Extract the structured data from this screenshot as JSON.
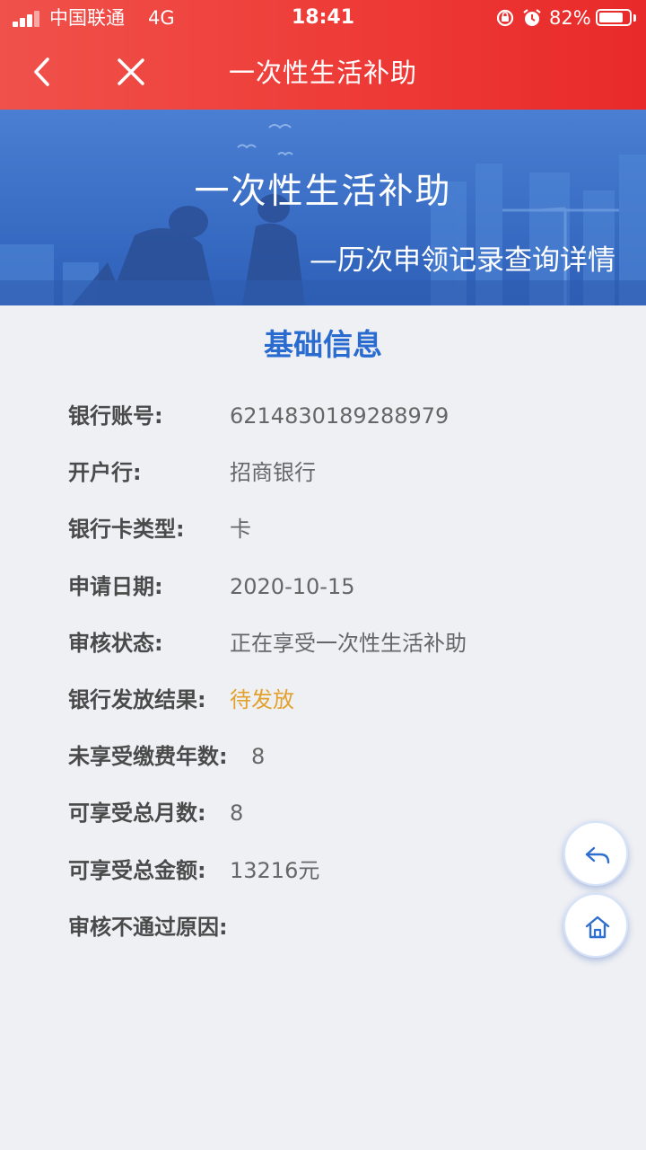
{
  "status_bar": {
    "carrier": "中国联通",
    "network": "4G",
    "time": "18:41",
    "battery_percent": "82%",
    "battery_level": 0.82
  },
  "navbar": {
    "title": "一次性生活补助",
    "back_icon": "chevron-left-icon",
    "close_icon": "close-icon"
  },
  "banner": {
    "title": "一次性生活补助",
    "subtitle": "—历次申领记录查询详情"
  },
  "section": {
    "title": "基础信息"
  },
  "info_rows": [
    {
      "label": "银行账号:",
      "value": "6214830189288979"
    },
    {
      "label": "开户行:",
      "value": "招商银行"
    },
    {
      "label": "银行卡类型:",
      "value": "卡"
    },
    {
      "label": "申请日期:",
      "value": "2020-10-15"
    },
    {
      "label": "审核状态:",
      "value": "正在享受一次性生活补助"
    },
    {
      "label": "银行发放结果:",
      "value": "待发放"
    },
    {
      "label": "未享受缴费年数:",
      "value": "8"
    },
    {
      "label": "可享受总月数:",
      "value": "8"
    },
    {
      "label": "可享受总金额:",
      "value": "13216元"
    },
    {
      "label": "审核不通过原因:",
      "value": ""
    }
  ],
  "colors": {
    "header_red": "#ee3b37",
    "banner_blue": "#3d72c9",
    "section_title_blue": "#2a6bd0",
    "pending_orange": "#e2a12c",
    "page_bg": "#eff0f4"
  },
  "floating_buttons": {
    "reply_icon": "reply-icon",
    "home_icon": "home-icon"
  }
}
